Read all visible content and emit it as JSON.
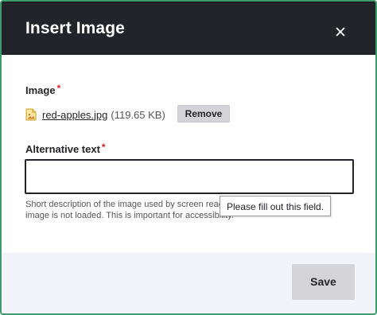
{
  "dialog": {
    "title": "Insert Image",
    "close_icon": "close-icon"
  },
  "image_field": {
    "label": "Image",
    "required_mark": "*",
    "file_icon": "image-file-icon",
    "file_name": "red-apples.jpg",
    "file_size": "(119.65 KB)",
    "remove_label": "Remove"
  },
  "alt_field": {
    "label": "Alternative text",
    "required_mark": "*",
    "value": "",
    "description_line1": "Short description of the image used by screen readers and displayed when the",
    "description_line2": "image is not loaded. This is important for accessibility."
  },
  "validation_tooltip": {
    "text": "Please fill out this field."
  },
  "footer": {
    "save_label": "Save"
  },
  "colors": {
    "header_bg": "#232429",
    "required": "#d72222",
    "button_bg": "#d4d4d8",
    "footer_bg": "#f3f4f9",
    "outline": "#3f9a6c"
  }
}
